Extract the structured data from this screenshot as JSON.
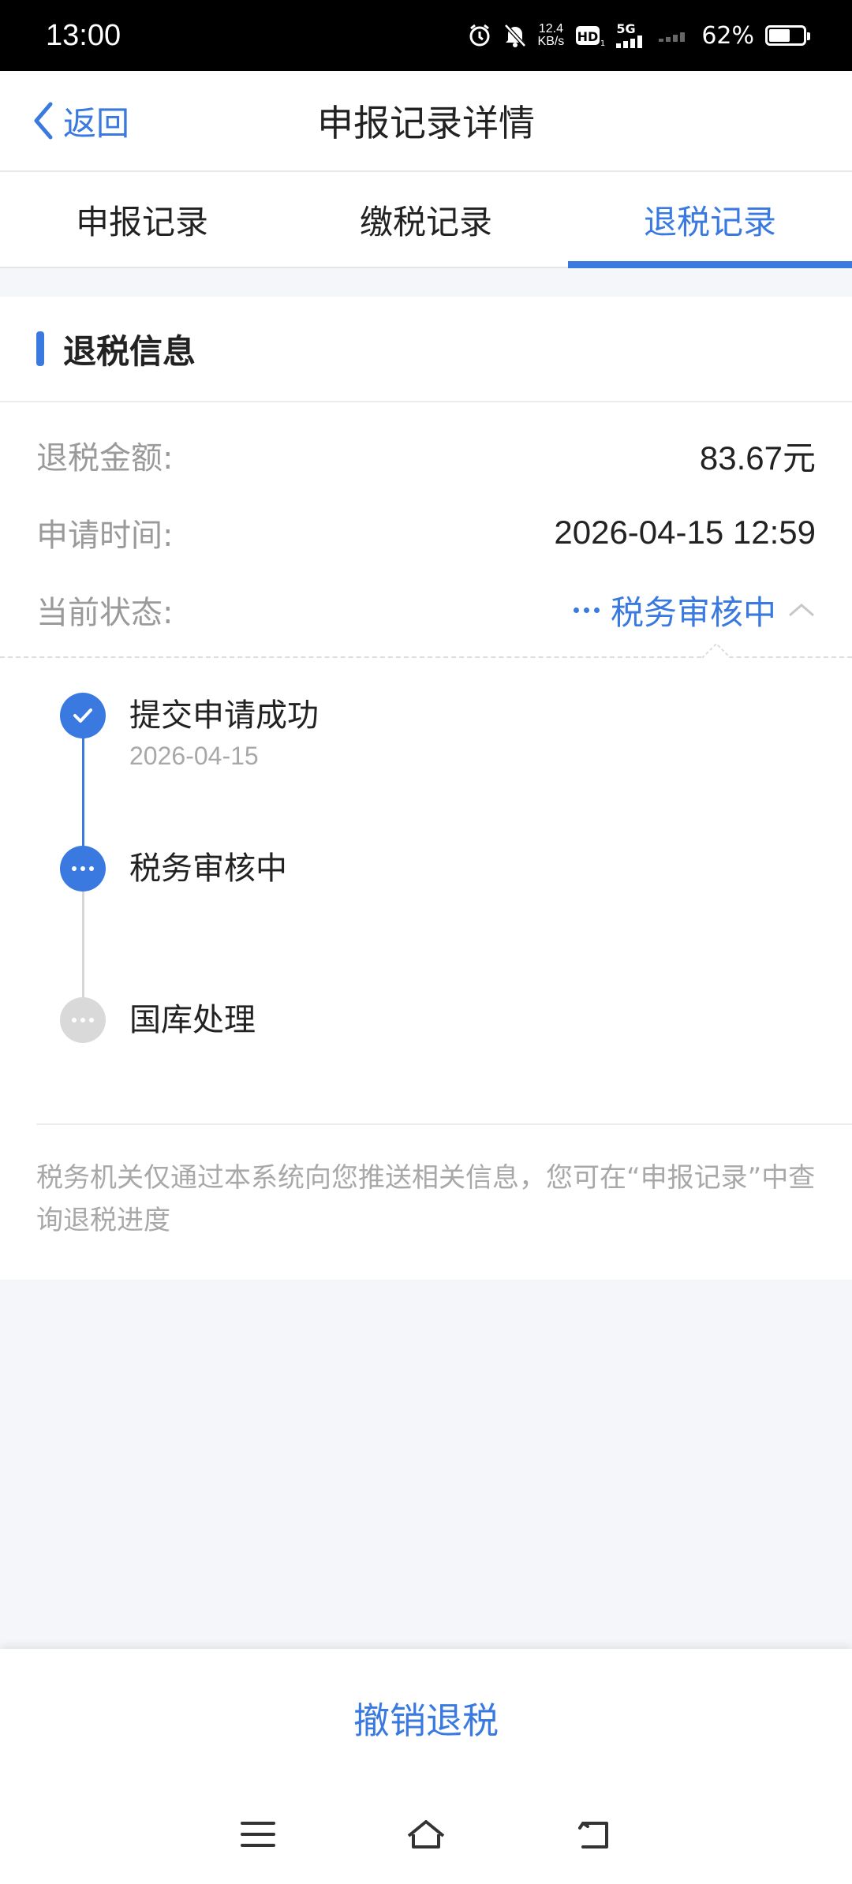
{
  "status_bar": {
    "time": "13:00",
    "speed_top": "12.4",
    "speed_unit": "KB/s",
    "network": "5G",
    "battery": "62%",
    "battery_level": 0.62
  },
  "header": {
    "back_label": "返回",
    "title": "申报记录详情"
  },
  "tabs": [
    {
      "label": "申报记录",
      "active": false
    },
    {
      "label": "缴税记录",
      "active": false
    },
    {
      "label": "退税记录",
      "active": true
    }
  ],
  "section": {
    "title": "退税信息",
    "rows": [
      {
        "label": "退税金额:",
        "value": "83.67元"
      },
      {
        "label": "申请时间:",
        "value": "2026-04-15 12:59"
      },
      {
        "label": "当前状态:",
        "value": "税务审核中"
      }
    ]
  },
  "timeline": [
    {
      "title": "提交申请成功",
      "date": "2026-04-15",
      "state": "done"
    },
    {
      "title": "税务审核中",
      "date": "",
      "state": "active"
    },
    {
      "title": "国库处理",
      "date": "",
      "state": "pending"
    }
  ],
  "note": "税务机关仅通过本系统向您推送相关信息，您可在“申报记录”中查询退税进度",
  "bottom": {
    "cancel_label": "撤销退税"
  },
  "icons": {
    "back": "chevron-left-icon",
    "status_expand": "chevron-up-icon",
    "nav_menu": "menu-icon",
    "nav_home": "home-icon",
    "nav_back": "back-icon"
  },
  "colors": {
    "accent": "#3a7ae0",
    "muted": "#9a9a9a",
    "background": "#f4f6fa"
  }
}
